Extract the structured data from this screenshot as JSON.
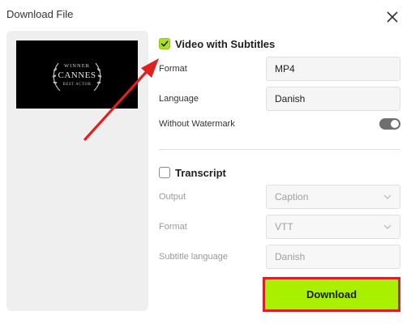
{
  "dialog": {
    "title": "Download File",
    "close_icon": "close-icon"
  },
  "preview": {
    "thumbnail_lines": [
      "WINNER",
      "CANNES",
      "BEST ACTOR"
    ]
  },
  "video_section": {
    "checked": true,
    "label": "Video with Subtitles",
    "format_label": "Format",
    "format_value": "MP4",
    "language_label": "Language",
    "language_value": "Danish",
    "watermark_label": "Without Watermark",
    "watermark_enabled": true
  },
  "transcript_section": {
    "checked": false,
    "label": "Transcript",
    "output_label": "Output",
    "output_value": "Caption",
    "format_label": "Format",
    "format_value": "VTT",
    "subtitle_language_label": "Subtitle language",
    "subtitle_language_value": "Danish"
  },
  "download": {
    "label": "Download"
  },
  "colors": {
    "accent_green": "#a9ef00",
    "highlight_red": "#d8202a",
    "annotation_arrow": "#e02020"
  }
}
